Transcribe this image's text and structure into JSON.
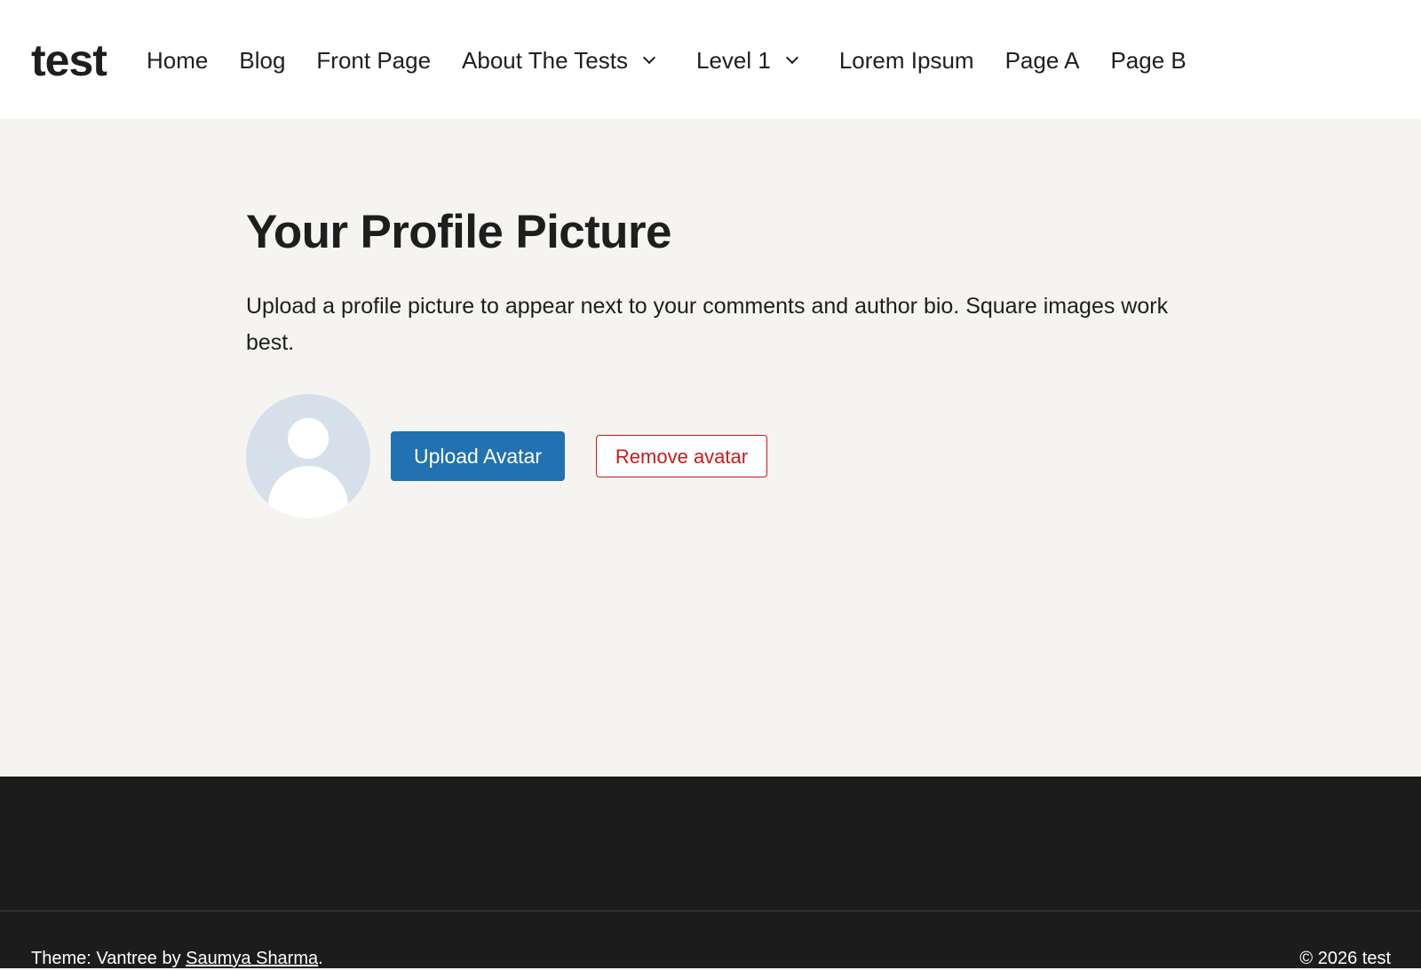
{
  "site": {
    "title": "test"
  },
  "nav": {
    "items": [
      {
        "label": "Home"
      },
      {
        "label": "Blog"
      },
      {
        "label": "Front Page"
      },
      {
        "label": "About The Tests",
        "has_submenu": true
      },
      {
        "label": "Level 1",
        "has_submenu": true
      },
      {
        "label": "Lorem Ipsum"
      },
      {
        "label": "Page A"
      },
      {
        "label": "Page B"
      }
    ]
  },
  "main": {
    "title": "Your Profile Picture",
    "description": "Upload a profile picture to appear next to your comments and author bio. Square images work best.",
    "avatar_icon": "default-user-silhouette",
    "upload_label": "Upload Avatar",
    "remove_label": "Remove avatar"
  },
  "footer": {
    "theme_prefix": "Theme: Vantree by ",
    "author_link": "Saumya Sharma",
    "theme_suffix": ".",
    "copyright": "© 2026 test"
  },
  "colors": {
    "header_bg": "#ffffff",
    "page_bg": "#f5f4f1",
    "footer_bg": "#1c1c1c",
    "primary_button": "#2271b1",
    "danger": "#cc1818",
    "avatar_bg": "#d6e0ea"
  }
}
